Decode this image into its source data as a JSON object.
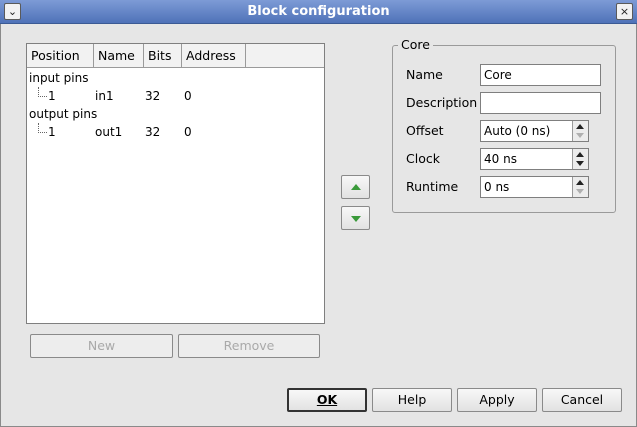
{
  "window": {
    "title": "Block configuration",
    "menu_glyph": "⌄",
    "close_glyph": "×"
  },
  "pin_list": {
    "columns": [
      "Position",
      "Name",
      "Bits",
      "Address"
    ],
    "groups": [
      {
        "label": "input pins",
        "pins": [
          {
            "position": "1",
            "name": "in1",
            "bits": "32",
            "address": "0"
          }
        ]
      },
      {
        "label": "output pins",
        "pins": [
          {
            "position": "1",
            "name": "out1",
            "bits": "32",
            "address": "0"
          }
        ]
      }
    ],
    "new_label": "New",
    "remove_label": "Remove"
  },
  "core": {
    "title": "Core",
    "name_label": "Name",
    "name_value": "Core",
    "description_label": "Description",
    "description_value": "",
    "offset_label": "Offset",
    "offset_value": "Auto (0 ns)",
    "clock_label": "Clock",
    "clock_value": "40 ns",
    "runtime_label": "Runtime",
    "runtime_value": "0 ns"
  },
  "buttons": {
    "ok": "OK",
    "help": "Help",
    "apply": "Apply",
    "cancel": "Cancel"
  },
  "icons": {
    "move_up": "green-up-arrow-icon",
    "move_down": "green-down-arrow-icon"
  },
  "colors": {
    "titlebar": "#5a7cc0",
    "arrow_green": "#3a9a3a"
  }
}
